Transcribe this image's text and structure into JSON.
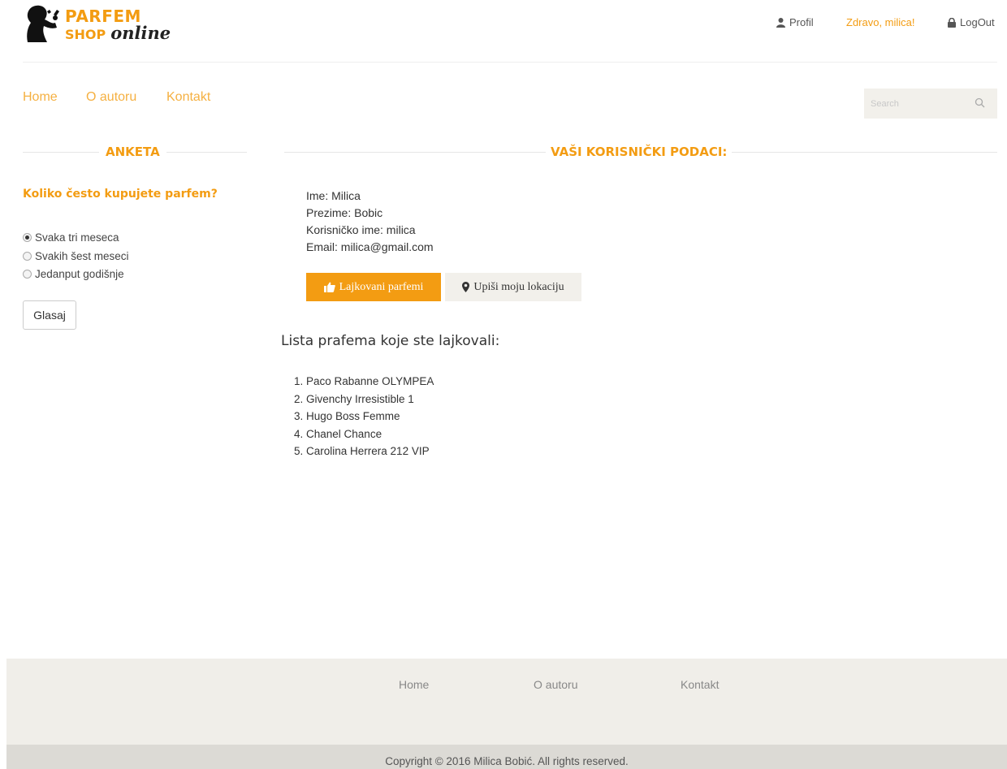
{
  "brand": {
    "line1": "PARFEM",
    "line2_shop": "SHOP",
    "line2_online": "online"
  },
  "header": {
    "profile_label": "Profil",
    "greeting": "Zdravo, milica!",
    "logout_label": "LogOut"
  },
  "nav": {
    "items": [
      "Home",
      "O autoru",
      "Kontakt"
    ],
    "search_placeholder": "Search"
  },
  "poll": {
    "title": "ANKETA",
    "question": "Koliko često kupujete parfem?",
    "options": [
      "Svaka tri meseca",
      "Svakih šest meseci",
      "Jedanput godišnje"
    ],
    "selected_index": 0,
    "vote_label": "Glasaj"
  },
  "user": {
    "title": "VAŠI KORISNIČKI PODACI:",
    "fields": [
      "Ime: Milica",
      "Prezime: Bobic",
      "Korisničko ime: milica",
      "Email: milica@gmail.com"
    ],
    "liked_button": "Lajkovani parfemi",
    "location_button": "Upiši moju lokaciju"
  },
  "liked": {
    "title": "Lista prafema koje ste lajkovali:",
    "items": [
      "1. Paco Rabanne OLYMPEA",
      "2. Givenchy Irresistible 1",
      "3. Hugo Boss Femme",
      "4. Chanel Chance",
      "5. Carolina Herrera 212 VIP"
    ]
  },
  "footer": {
    "links": [
      "Home",
      "O autoru",
      "Kontakt"
    ],
    "copyright": "Copyright © 2016 Milica Bobić. All rights reserved."
  },
  "colors": {
    "accent": "#f39c12",
    "nav": "#f5b041",
    "footer_bg": "#f0eee9",
    "footer_bottom": "#dcdad5"
  }
}
